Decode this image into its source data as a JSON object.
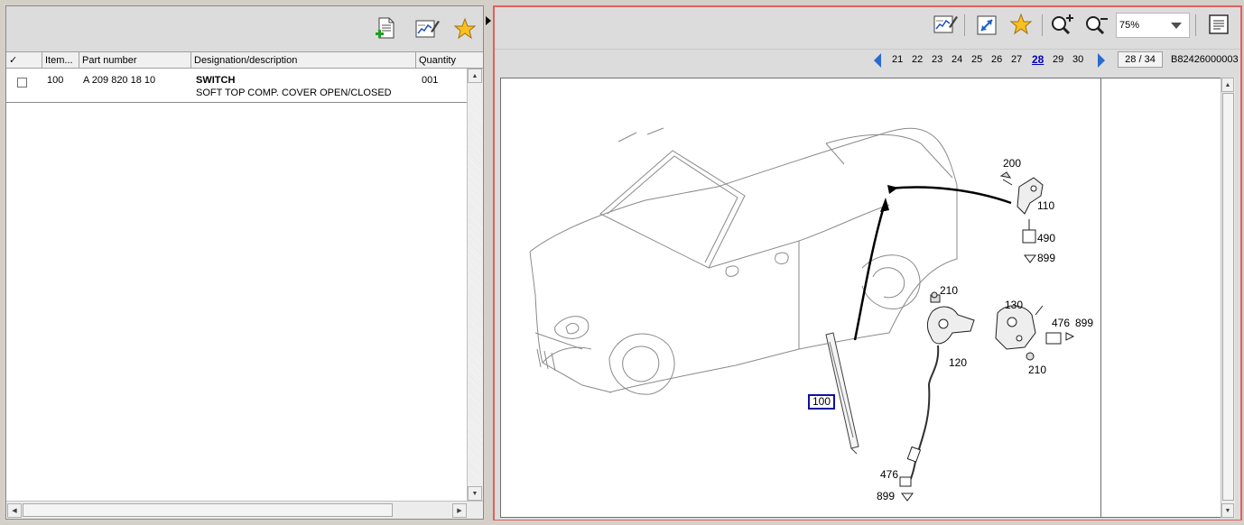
{
  "left_toolbar": {
    "icons": [
      "add-document-icon",
      "edit-chart-icon",
      "favorite-star-icon"
    ]
  },
  "parts_table": {
    "columns": [
      "✓",
      "Item...",
      "Part number",
      "Designation/description",
      "Quantity"
    ],
    "rows": [
      {
        "item": "100",
        "part_number": "A 209 820 18 10",
        "designation": "SWITCH",
        "description": "SOFT TOP COMP. COVER OPEN/CLOSED",
        "quantity": "001"
      }
    ]
  },
  "right_toolbar": {
    "icons": [
      "edit-chart-icon",
      "resize-icon",
      "favorite-star-icon",
      "zoom-in-icon",
      "zoom-out-icon",
      "page-icon"
    ],
    "zoom_value": "75%"
  },
  "navigation": {
    "pages": [
      "21",
      "22",
      "23",
      "24",
      "25",
      "26",
      "27",
      "28",
      "29",
      "30"
    ],
    "current_page": "28",
    "page_count": "28 / 34",
    "document_id": "B82426000003"
  },
  "diagram": {
    "callouts": [
      "200",
      "110",
      "490",
      "899",
      "210",
      "130",
      "476",
      "899",
      "120",
      "210",
      "100",
      "476",
      "899"
    ],
    "highlighted_callout": "100"
  },
  "colors": {
    "highlight_frame": "#e06060",
    "callout_highlight": "#1010a0",
    "current_page_link": "#0000c0"
  }
}
